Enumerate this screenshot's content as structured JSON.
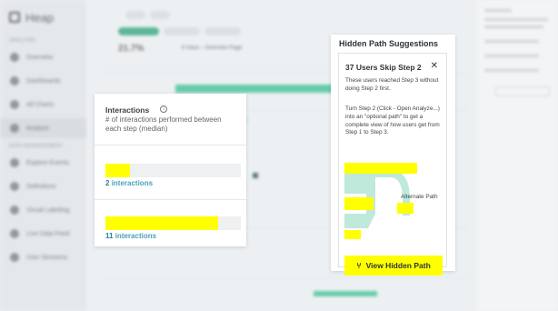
{
  "app": {
    "logo_text": "Heap"
  },
  "sidebar": {
    "section_analysis": "Analysis",
    "section_data": "Data Management",
    "items": [
      {
        "label": "Overview",
        "icon": "grid-icon"
      },
      {
        "label": "Dashboards",
        "icon": "dashboard-icon"
      },
      {
        "label": "All Charts",
        "icon": "chart-icon"
      },
      {
        "label": "Analyze",
        "icon": "analyze-icon",
        "active": true
      },
      {
        "label": "Explore Events",
        "icon": "events-icon"
      },
      {
        "label": "Definitions",
        "icon": "definitions-icon"
      },
      {
        "label": "Visual Labeling",
        "icon": "labeling-icon"
      },
      {
        "label": "Live Data Feed",
        "icon": "feed-icon"
      },
      {
        "label": "User Sessions",
        "icon": "sessions-icon"
      }
    ]
  },
  "main": {
    "stat_value": "21.7%",
    "stat_caption": "6 Have – Overview Page"
  },
  "interactions_popover": {
    "title": "Interactions",
    "info_icon": "info-icon",
    "subtitle": "# of interactions performed between each step (median)",
    "rows": [
      {
        "count": "2",
        "unit": "interactions",
        "fill_fraction": 0.18
      },
      {
        "count": "11",
        "unit": "interactions",
        "fill_fraction": 0.83
      }
    ],
    "highlight_color": "#ffff00"
  },
  "hidden_path": {
    "panel_title": "Hidden Path Suggestions",
    "card_title": "37 Users Skip Step 2",
    "close_icon": "close-icon",
    "para1": "These users reached Step 3 without doing Step 2 first.",
    "para2": "Turn Step 2 (Click - Open Analyze...) into an \"optional path\" to get a complete view of how users get from Step 1 to Step 3.",
    "diagram_label": "Alternate Path",
    "button_label": "View Hidden Path",
    "button_icon": "branch-icon",
    "flow_color": "#bfe9db",
    "highlight_color": "#ffff00"
  }
}
